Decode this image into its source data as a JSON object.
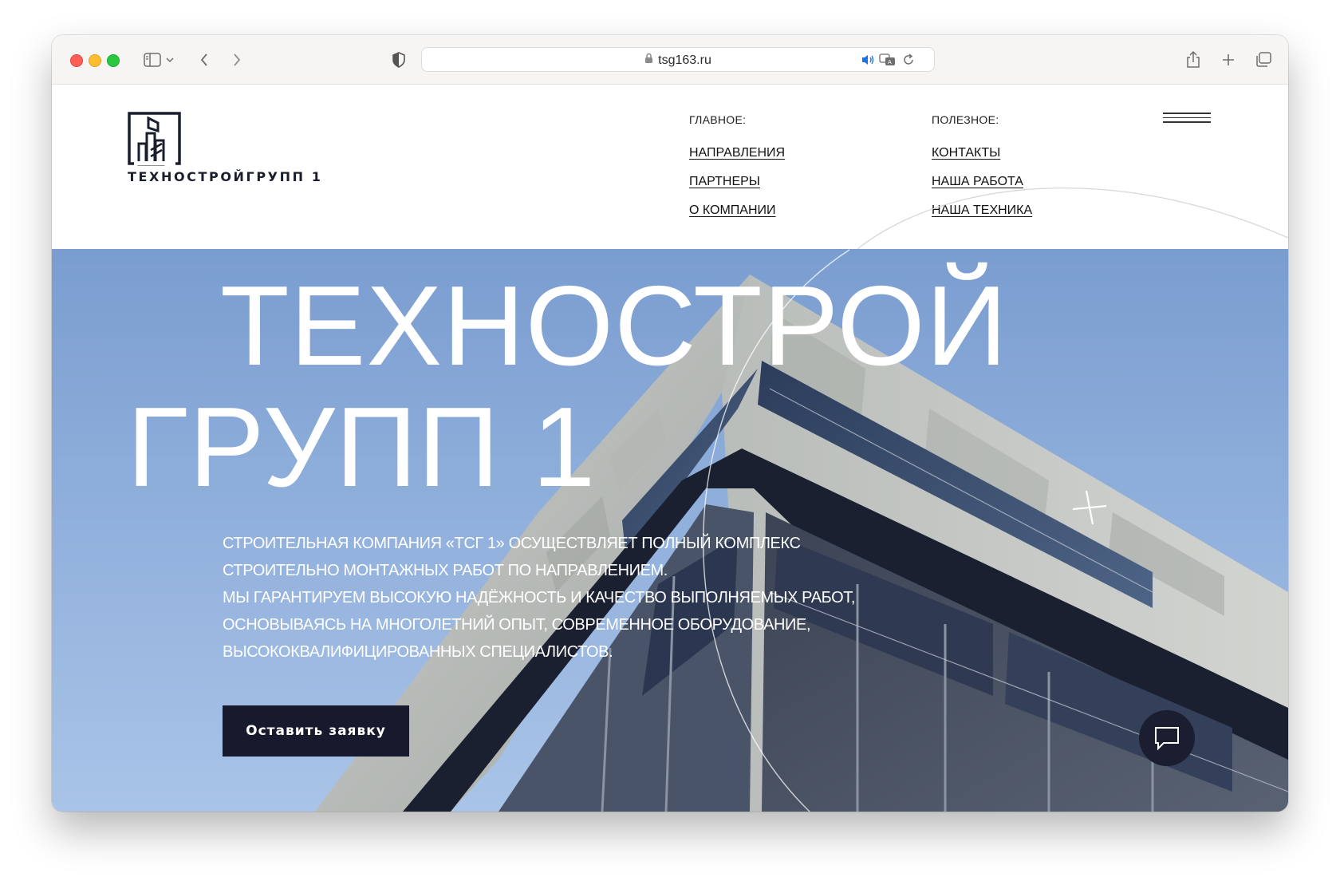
{
  "browser": {
    "url": "tsg163.ru",
    "icons": [
      "sidebar-icon",
      "chevron-down-icon",
      "back-icon",
      "forward-icon",
      "shield-icon",
      "lock-icon",
      "speaker-icon",
      "translate-icon",
      "reload-icon",
      "share-icon",
      "plus-icon",
      "tabs-icon"
    ]
  },
  "header": {
    "logo_text": "ТЕХНОСТРОЙГРУПП 1",
    "nav_main": {
      "heading": "ГЛАВНОЕ:",
      "links": [
        "НАПРАВЛЕНИЯ",
        "ПАРТНЕРЫ",
        "О КОМПАНИИ"
      ]
    },
    "nav_useful": {
      "heading": "ПОЛЕЗНОЕ:",
      "links": [
        "КОНТАКТЫ",
        "НАША РАБОТА",
        "НАША ТЕХНИКА"
      ]
    }
  },
  "hero": {
    "title_line1": "ТЕХНОСТРОЙ",
    "title_line2": "ГРУПП 1",
    "description": [
      "СТРОИТЕЛЬНАЯ КОМПАНИЯ «ТСГ 1» ОСУЩЕСТВЛЯЕТ ПОЛНЫЙ КОМПЛЕКС",
      "СТРОИТЕЛЬНО МОНТАЖНЫХ РАБОТ ПО НАПРАВЛЕНИЕМ.",
      "МЫ ГАРАНТИРУЕМ ВЫСОКУЮ НАДЁЖНОСТЬ И КАЧЕСТВО ВЫПОЛНЯЕМЫХ РАБОТ,",
      "ОСНОВЫВАЯСЬ НА МНОГОЛЕТНИЙ ОПЫТ, СОВРЕМЕННОЕ ОБОРУДОВАНИЕ,",
      "ВЫСОКОКВАЛИФИЦИРОВАННЫХ СПЕЦИАЛИСТОВ."
    ],
    "cta_label": "Оставить заявку"
  },
  "colors": {
    "dark_navy": "#171a2c",
    "sky": "#8fb0dc",
    "white": "#ffffff"
  }
}
